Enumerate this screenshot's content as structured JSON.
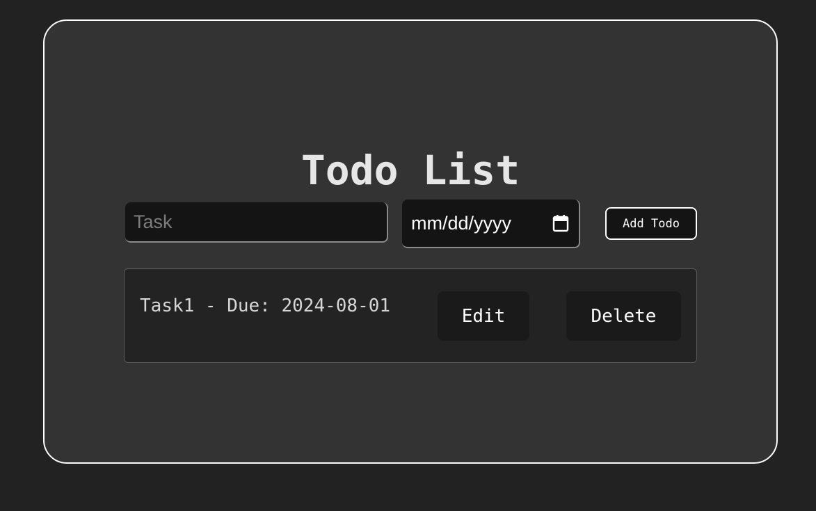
{
  "title": "Todo List",
  "form": {
    "task_placeholder": "Task",
    "task_value": "",
    "date_placeholder": "mm/dd/yyyy",
    "add_label": "Add Todo"
  },
  "todos": [
    {
      "text": "Task1 - Due: 2024-08-01",
      "edit_label": "Edit",
      "delete_label": "Delete"
    }
  ],
  "icons": {
    "date_picker": "calendar-icon"
  },
  "colors": {
    "background": "#222222",
    "card": "#333333",
    "border": "#ffffff",
    "input": "#141414",
    "title": "#e6e6e6"
  }
}
